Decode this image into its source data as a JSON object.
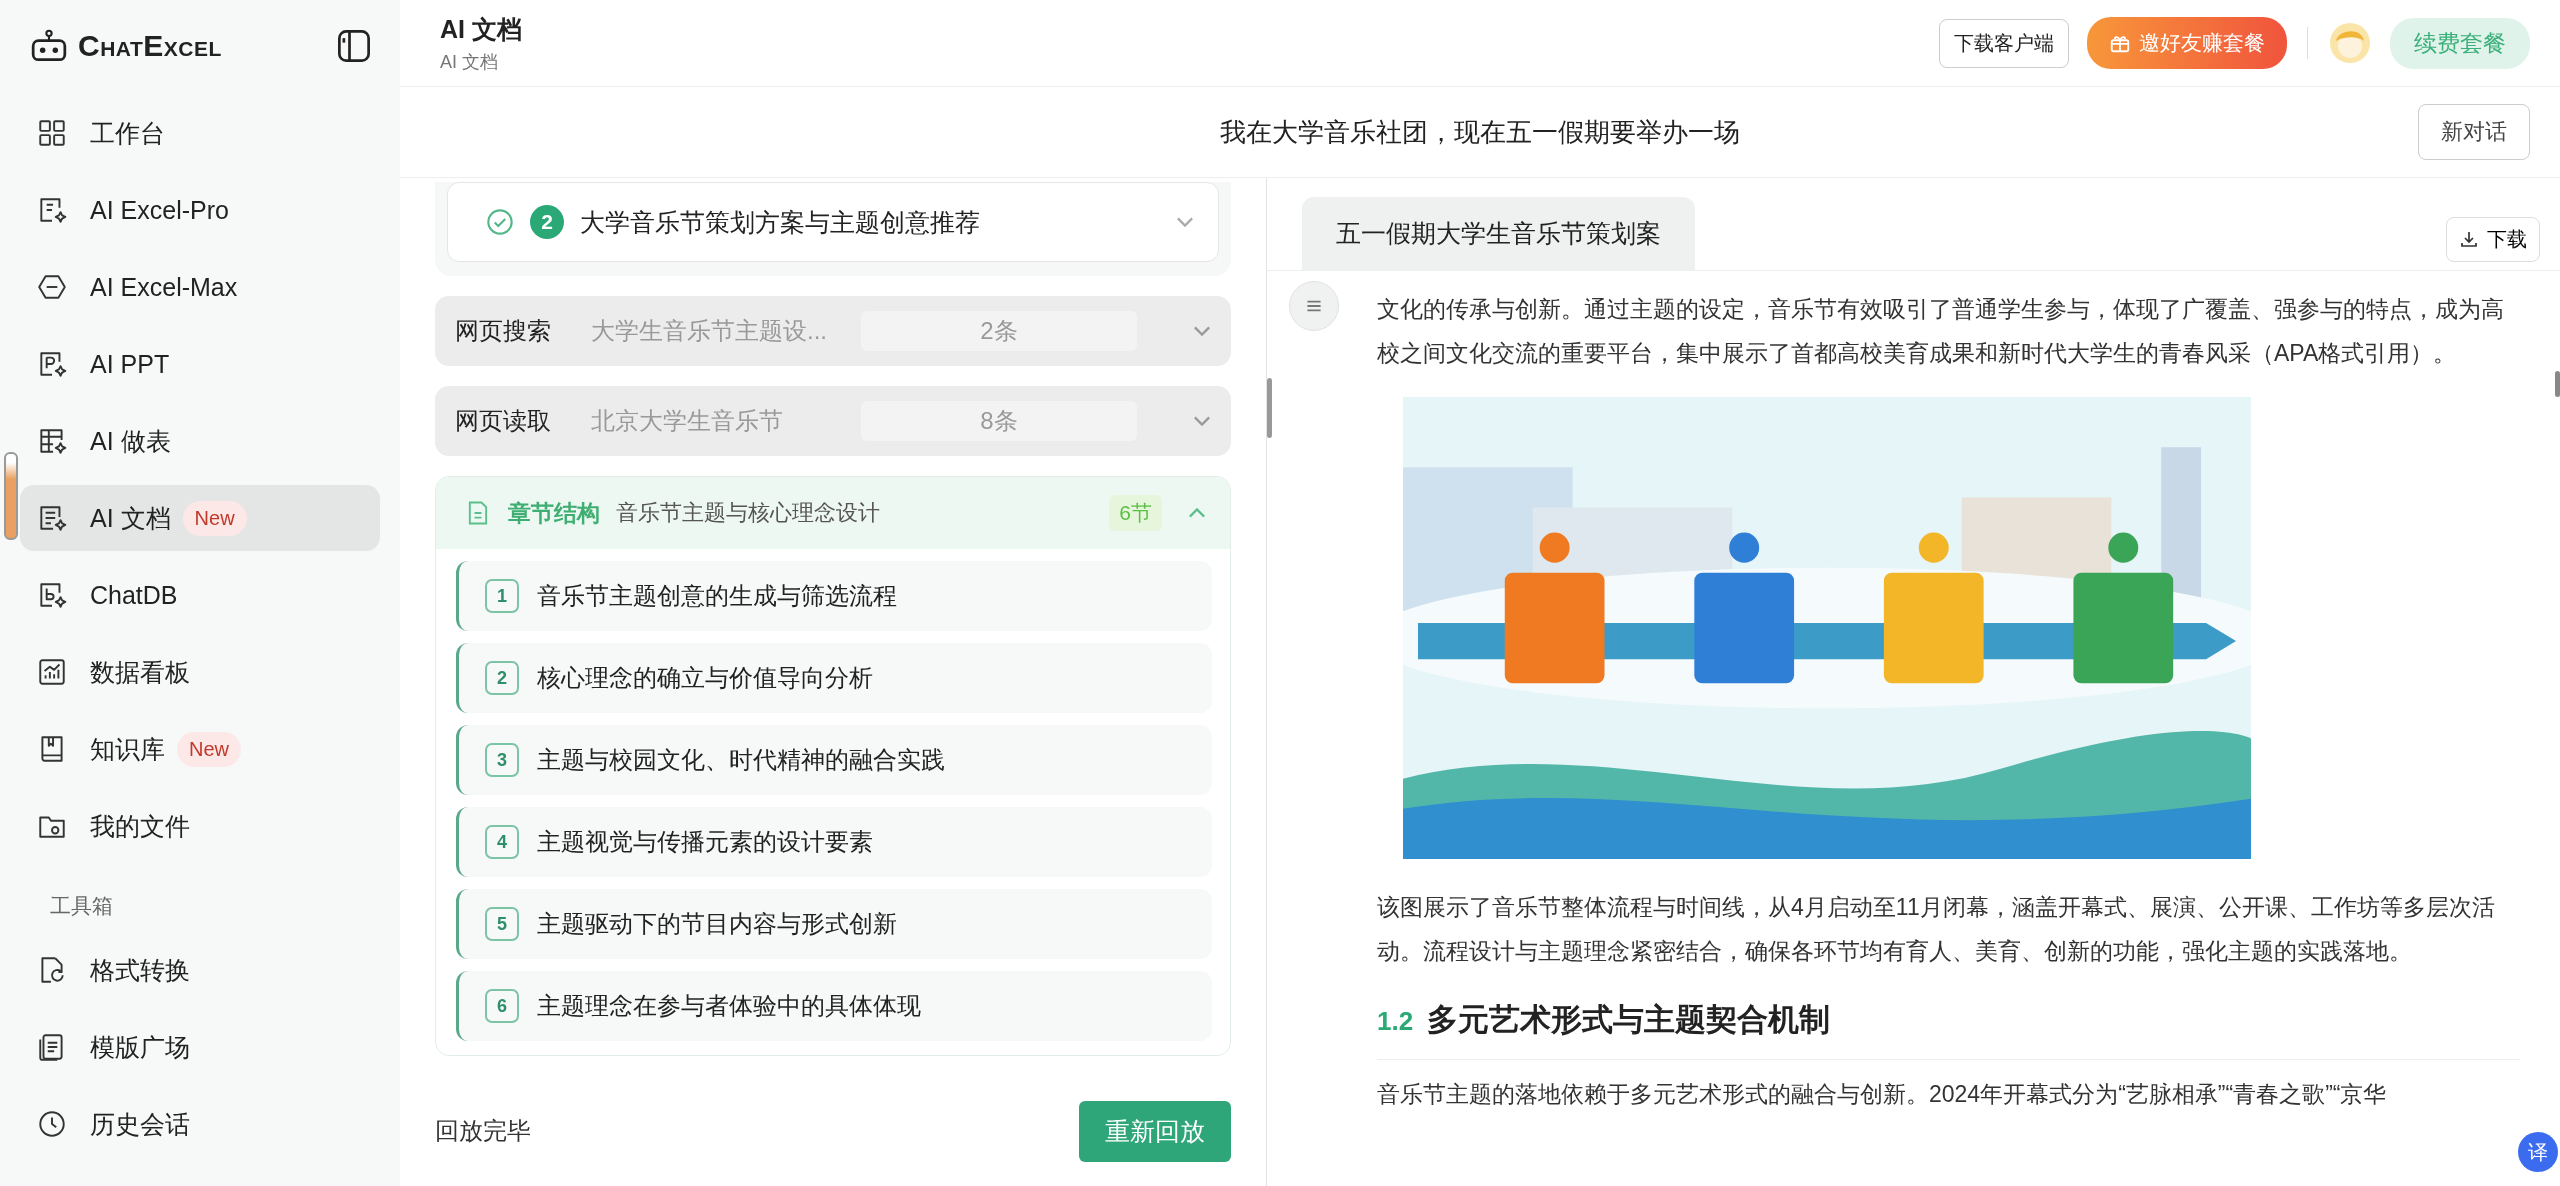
{
  "sidebar": {
    "logo": "ChatExcel",
    "items": [
      {
        "label": "工作台",
        "selected": false
      },
      {
        "label": "AI Excel-Pro",
        "selected": false
      },
      {
        "label": "AI Excel-Max",
        "selected": false
      },
      {
        "label": "AI PPT",
        "selected": false
      },
      {
        "label": "AI 做表",
        "selected": false
      },
      {
        "label": "AI 文档",
        "badge": "New",
        "selected": true
      },
      {
        "label": "ChatDB",
        "selected": false
      },
      {
        "label": "数据看板",
        "selected": false
      },
      {
        "label": "知识库",
        "badge": "New",
        "selected": false
      },
      {
        "label": "我的文件",
        "selected": false
      }
    ],
    "section_label": "工具箱",
    "tools": [
      {
        "label": "格式转换",
        "selected": false
      },
      {
        "label": "模版广场",
        "selected": false
      },
      {
        "label": "历史会话",
        "selected": false
      }
    ]
  },
  "header": {
    "title": "AI 文档",
    "breadcrumb": "AI 文档",
    "download_client": "下载客户端",
    "invite": "邀好友赚套餐",
    "renew": "续费套餐"
  },
  "conversation": {
    "prompt": "我在大学音乐社团，现在五一假期要举办一场",
    "new_chat": "新对话"
  },
  "steps_panel": {
    "step": {
      "number": "2",
      "title": "大学音乐节策划方案与主题创意推荐",
      "completed": true,
      "expanded": false
    },
    "sources": [
      {
        "label": "网页搜索",
        "query": "大学生音乐节主题设...",
        "count": "2条",
        "expanded": false
      },
      {
        "label": "网页读取",
        "query": "北京大学生音乐节",
        "count": "8条",
        "expanded": false
      }
    ],
    "chapters": {
      "label": "章节结构",
      "subtitle": "音乐节主题与核心理念设计",
      "count": "6节",
      "expanded": true,
      "items": [
        {
          "number": "1",
          "title": "音乐节主题创意的生成与筛选流程"
        },
        {
          "number": "2",
          "title": "核心理念的确立与价值导向分析"
        },
        {
          "number": "3",
          "title": "主题与校园文化、时代精神的融合实践"
        },
        {
          "number": "4",
          "title": "主题视觉与传播元素的设计要素"
        },
        {
          "number": "5",
          "title": "主题驱动下的节目内容与形式创新"
        },
        {
          "number": "6",
          "title": "主题理念在参与者体验中的具体体现"
        }
      ]
    },
    "status": "回放完毕",
    "replay": "重新回放"
  },
  "document": {
    "tab": "五一假期大学生音乐节策划案",
    "download": "下载",
    "paragraph_1": "文化的传承与创新。通过主题的设定，音乐节有效吸引了普通学生参与，体现了广覆盖、强参与的特点，成为高校之间文化交流的重要平台，集中展示了首都高校美育成果和新时代大学生的青春风采（APA格式引用）。",
    "paragraph_2": "该图展示了音乐节整体流程与时间线，从4月启动至11月闭幕，涵盖开幕式、展演、公开课、工作坊等多层次活动。流程设计与主题理念紧密结合，确保各环节均有育人、美育、创新的功能，强化主题的实践落地。",
    "heading": {
      "number": "1.2",
      "title": "多元艺术形式与主题契合机制"
    },
    "paragraph_3": "音乐节主题的落地依赖于多元艺术形式的融合与创新。2024年开幕式分为“艺脉相承”“青春之歌”“京华",
    "translate": "译"
  }
}
